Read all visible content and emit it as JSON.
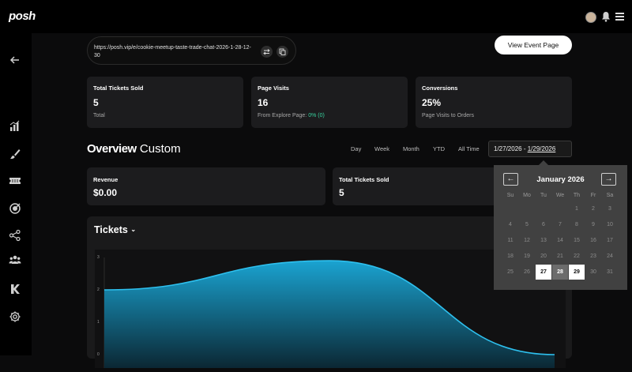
{
  "app": {
    "logo": "posh"
  },
  "topbar": {
    "icons": [
      "avatar",
      "bell-icon",
      "menu-icon"
    ]
  },
  "sidebar": {
    "icons": [
      "back-arrow-icon",
      "analytics-icon",
      "brush-icon",
      "ticket-icon",
      "target-icon",
      "share-icon",
      "team-icon",
      "kickback-icon",
      "settings-icon"
    ]
  },
  "link": {
    "url": "https://posh.vip/e/cookie-meetup-taste-trade-chat-2026-1-28-12-30",
    "view_event_label": "View Event Page"
  },
  "stats": [
    {
      "title": "Total Tickets Sold",
      "value": "5",
      "sub": "Total",
      "sub_extra": ""
    },
    {
      "title": "Page Visits",
      "value": "16",
      "sub": "From Explore Page:",
      "sub_extra": "0% (0)"
    },
    {
      "title": "Conversions",
      "value": "25%",
      "sub": "Page Visits to Orders",
      "sub_extra": ""
    }
  ],
  "overview": {
    "title_bold": "Overview",
    "title_rest": "Custom",
    "ranges": [
      "Day",
      "Week",
      "Month",
      "YTD",
      "All Time"
    ],
    "date_start": "1/27/2026",
    "date_sep": " - ",
    "date_end": "1/29/2026"
  },
  "summary": [
    {
      "title": "Revenue",
      "value": "$0.00"
    },
    {
      "title": "Total Tickets Sold",
      "value": "5"
    }
  ],
  "calendar": {
    "month": "January 2026",
    "prev": "←",
    "next": "→",
    "weekdays": [
      "Su",
      "Mo",
      "Tu",
      "We",
      "Th",
      "Fr",
      "Sa"
    ],
    "rows": [
      [
        "",
        "",
        "",
        "",
        "1",
        "2",
        "3"
      ],
      [
        "4",
        "5",
        "6",
        "7",
        "8",
        "9",
        "10"
      ],
      [
        "11",
        "12",
        "13",
        "14",
        "15",
        "16",
        "17"
      ],
      [
        "18",
        "19",
        "20",
        "21",
        "22",
        "23",
        "24"
      ],
      [
        "25",
        "26",
        "27",
        "28",
        "29",
        "30",
        "31"
      ]
    ],
    "selected_start": "27",
    "selected_mid": "28",
    "selected_end": "29"
  },
  "tickets_chart": {
    "title": "Tickets"
  },
  "chart_data": {
    "type": "area",
    "title": "Tickets",
    "xlabel": "",
    "ylabel": "",
    "ylim": [
      0,
      3
    ],
    "yticks": [
      "3",
      "2",
      "1",
      "0"
    ],
    "x": [
      0,
      1,
      2
    ],
    "values": [
      2,
      2.9,
      0
    ]
  },
  "colors": {
    "accent_green": "#38d39f",
    "area_top": "#1aa3d1",
    "area_bottom": "#0b2733",
    "card": "#1c1c1e"
  }
}
